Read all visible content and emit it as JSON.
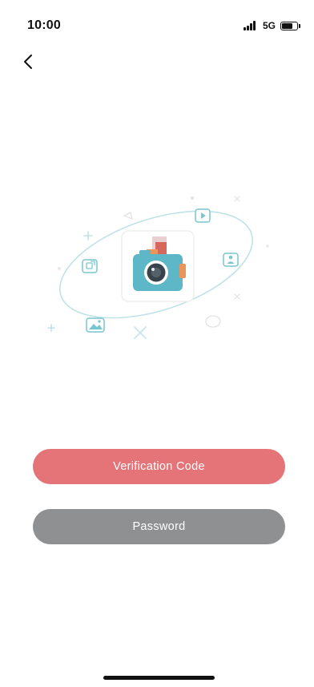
{
  "status_bar": {
    "time": "10:00",
    "network": "5G",
    "battery_level": 0.75
  },
  "nav": {
    "back_icon": "chevron-left-icon"
  },
  "illustration": {
    "icons": [
      "camera-icon",
      "play-icon",
      "user-icon",
      "image-icon",
      "share-icon"
    ],
    "colors": {
      "teal": "#79c6cf",
      "camera_body": "#5db7c7",
      "orange": "#e9955c",
      "red": "#d7665d"
    }
  },
  "actions": {
    "verification_label": "Verification Code",
    "password_label": "Password"
  },
  "colors": {
    "verification": "#e57478",
    "password": "#8f9092"
  }
}
